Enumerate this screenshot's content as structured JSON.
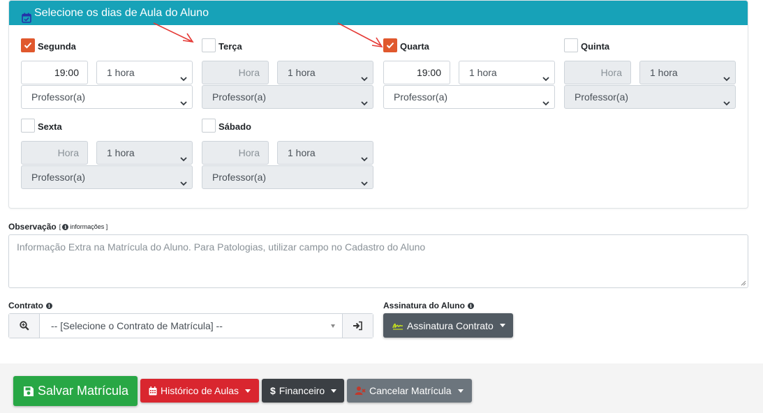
{
  "card": {
    "title": "Selecione os dias de Aula do Aluno"
  },
  "days": [
    {
      "label": "Segunda",
      "checked": true,
      "hora": "19:00",
      "duracao": "1 hora",
      "professor": "Professor(a)"
    },
    {
      "label": "Terça",
      "checked": false,
      "hora": "Hora",
      "duracao": "1 hora",
      "professor": "Professor(a)"
    },
    {
      "label": "Quarta",
      "checked": true,
      "hora": "19:00",
      "duracao": "1 hora",
      "professor": "Professor(a)"
    },
    {
      "label": "Quinta",
      "checked": false,
      "hora": "Hora",
      "duracao": "1 hora",
      "professor": "Professor(a)"
    },
    {
      "label": "Sexta",
      "checked": false,
      "hora": "Hora",
      "duracao": "1 hora",
      "professor": "Professor(a)"
    },
    {
      "label": "Sábado",
      "checked": false,
      "hora": "Hora",
      "duracao": "1 hora",
      "professor": "Professor(a)"
    }
  ],
  "observacao": {
    "label": "Observação",
    "info_open": "[",
    "info_text": "informações ]",
    "placeholder": "Informação Extra na Matrícula do Aluno. Para Patologias, utilizar campo no Cadastro do Aluno"
  },
  "contrato": {
    "label": "Contrato",
    "select_value": "-- [Selecione o Contrato de Matrícula] --"
  },
  "assinatura": {
    "label": "Assinatura do Aluno",
    "button_label": "Assinatura Contrato"
  },
  "footer": {
    "save_label": "Salvar Matrícula",
    "historico_label": "Histórico de Aulas",
    "financeiro_label": "Financeiro",
    "cancelar_label": "Cancelar Matrícula"
  },
  "colors": {
    "header": "#17a2b8",
    "checked": "#e0582d",
    "save": "#28a745",
    "historico": "#d9262f",
    "financeiro": "#3b3f44",
    "cancelar": "#6c757d",
    "annotation_arrow": "#e53935"
  },
  "icons": {
    "header": "calendar-check-icon",
    "info": "info-circle-icon",
    "contrato_left": "search-plus-icon",
    "contrato_right": "sign-in-icon",
    "assinatura": "signature-icon",
    "save": "save-icon",
    "historico": "calendar-icon",
    "financeiro": "dollar-icon",
    "cancelar": "user-times-icon"
  }
}
